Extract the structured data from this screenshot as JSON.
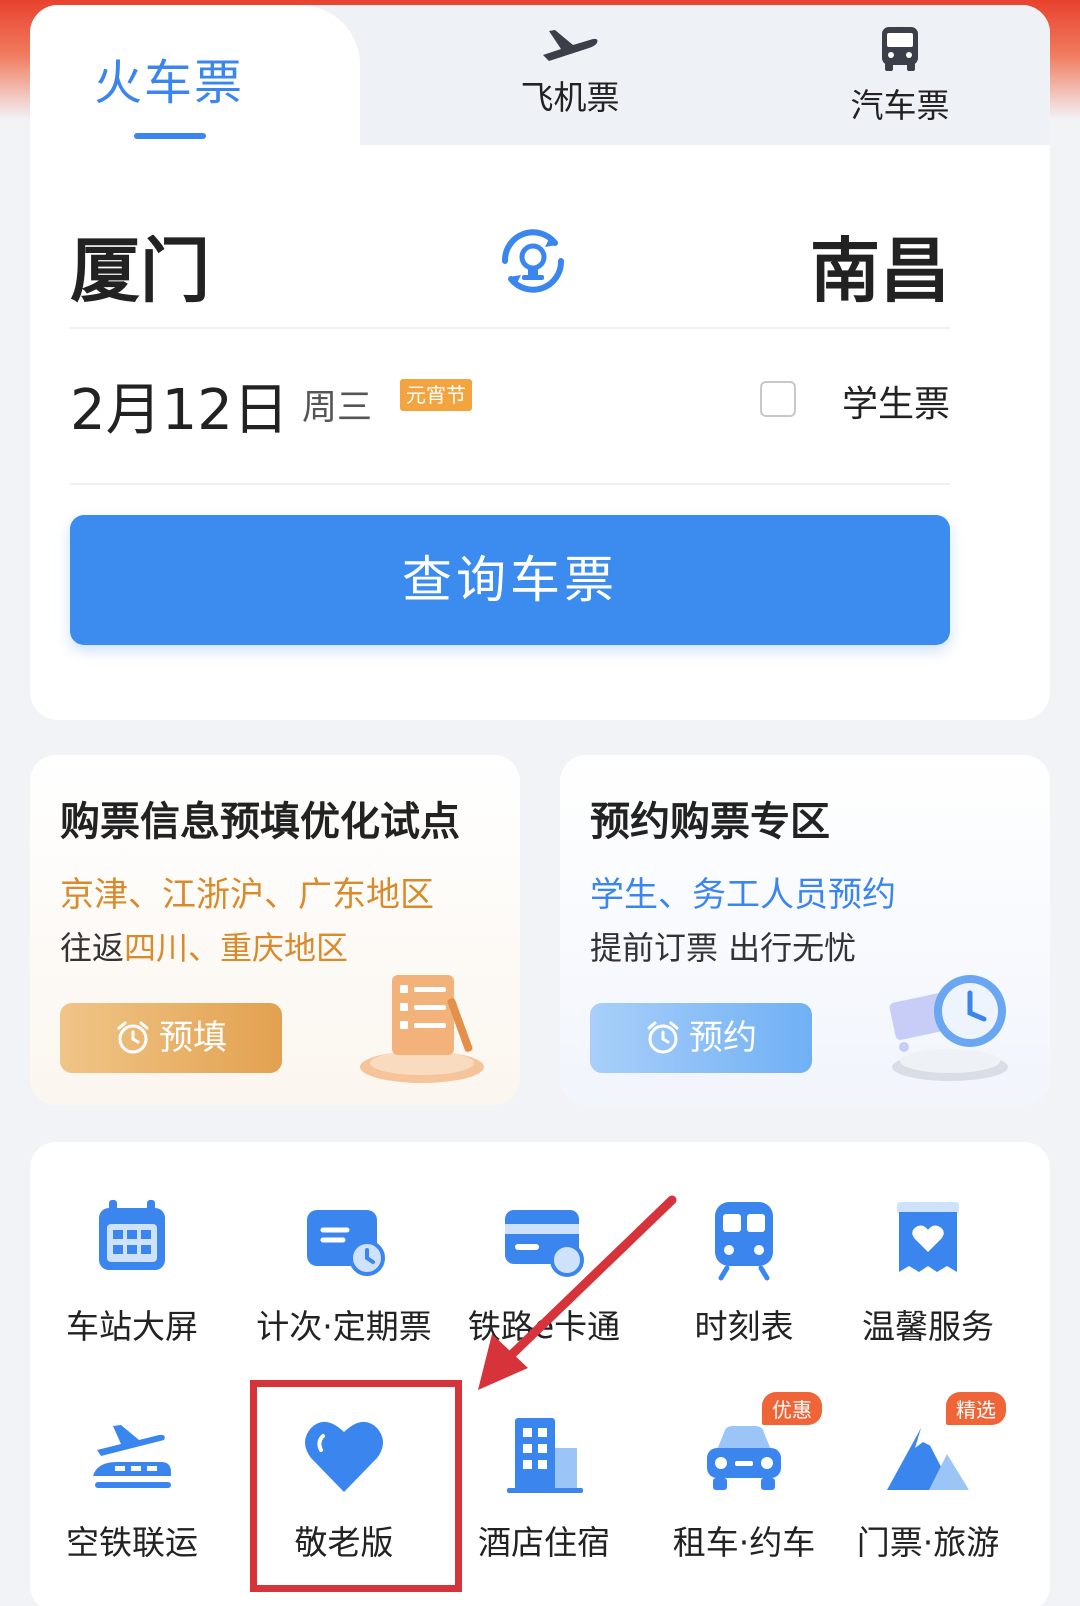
{
  "tabs": {
    "train": "火车票",
    "flight": "飞机票",
    "bus": "汽车票"
  },
  "route": {
    "from": "厦门",
    "to": "南昌"
  },
  "date": {
    "main": "2月12日",
    "weekday": "周三",
    "holiday": "元宵节"
  },
  "student": {
    "label": "学生票",
    "checked": false
  },
  "search_button": "查询车票",
  "promo_left": {
    "title": "购票信息预填优化试点",
    "line1": "京津、江浙沪、广东地区",
    "line2_prefix": "往返",
    "line2_highlight": "四川、重庆地区",
    "button": "预填"
  },
  "promo_right": {
    "title": "预约购票专区",
    "line1": "学生、务工人员预约",
    "line2": "提前订票 出行无忧",
    "button": "预约"
  },
  "services": [
    {
      "label": "车站大屏",
      "icon": "calendar-icon"
    },
    {
      "label": "计次·定期票",
      "icon": "ticket-card-icon"
    },
    {
      "label": "铁路e卡通",
      "icon": "ecard-icon"
    },
    {
      "label": "时刻表",
      "icon": "train-icon"
    },
    {
      "label": "温馨服务",
      "icon": "heart-box-icon"
    },
    {
      "label": "空铁联运",
      "icon": "plane-train-icon"
    },
    {
      "label": "敬老版",
      "icon": "heart-icon"
    },
    {
      "label": "酒店住宿",
      "icon": "hotel-icon"
    },
    {
      "label": "租车·约车",
      "icon": "car-icon",
      "badge": "优惠"
    },
    {
      "label": "门票·旅游",
      "icon": "mountain-icon",
      "badge": "精选"
    }
  ],
  "colors": {
    "accent": "#3a86ee",
    "orange": "#d98a2b",
    "highlight": "#d6333a"
  }
}
